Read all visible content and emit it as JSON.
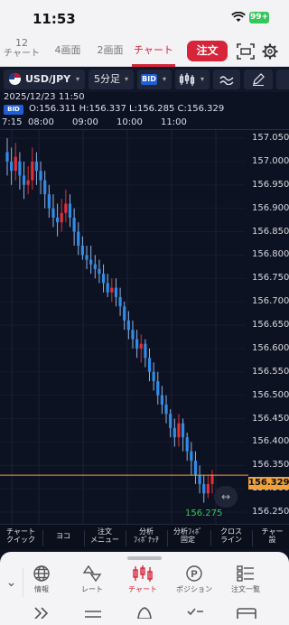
{
  "status": {
    "time": "11:53",
    "battery": "99+"
  },
  "header": {
    "tabs": [
      {
        "top": "12",
        "bottom": "チャート"
      },
      {
        "label": "4画面"
      },
      {
        "label": "2画面"
      },
      {
        "label": "チャート"
      }
    ],
    "order_label": "注文"
  },
  "toolbar": {
    "pair": "USD/JPY",
    "interval": "5分足",
    "price_type": "BID"
  },
  "info": {
    "datetime": "2025/12/23 11:50",
    "bid_tag": "BID",
    "ohlc": "O:156.311 H:156.337 L:156.285 C:156.329"
  },
  "time_axis": [
    "7:15",
    "08:00",
    "09:00",
    "10:00",
    "11:00"
  ],
  "chart_data": {
    "type": "candlestick",
    "title": "",
    "xlabel": "",
    "ylabel": "",
    "ylim": [
      156.23,
      157.1
    ],
    "x": [
      "07:15",
      "08:00",
      "09:00",
      "10:00",
      "11:00"
    ],
    "y_ticks": [
      "157.050",
      "157.000",
      "156.950",
      "156.900",
      "156.850",
      "156.800",
      "156.750",
      "156.700",
      "156.650",
      "156.600",
      "156.550",
      "156.500",
      "156.450",
      "156.400",
      "156.350",
      "156.300",
      "156.250"
    ],
    "current_price": "156.329",
    "low_label": "156.275",
    "series": [
      {
        "values": [
          [
            157.02,
            157.0,
            157.05,
            156.97
          ],
          [
            157.0,
            156.98,
            157.03,
            156.95
          ],
          [
            156.98,
            157.01,
            157.04,
            156.96
          ],
          [
            157.0,
            156.97,
            157.02,
            156.94
          ],
          [
            156.97,
            156.95,
            157.0,
            156.92
          ],
          [
            156.95,
            156.96,
            156.99,
            156.93
          ],
          [
            156.96,
            157.0,
            157.03,
            156.94
          ],
          [
            157.0,
            156.98,
            157.02,
            156.95
          ],
          [
            156.98,
            156.96,
            157.0,
            156.93
          ],
          [
            156.96,
            156.93,
            156.98,
            156.9
          ],
          [
            156.93,
            156.9,
            156.95,
            156.88
          ],
          [
            156.9,
            156.88,
            156.93,
            156.86
          ],
          [
            156.88,
            156.87,
            156.91,
            156.84
          ],
          [
            156.87,
            156.89,
            156.92,
            156.85
          ],
          [
            156.89,
            156.91,
            156.94,
            156.87
          ],
          [
            156.91,
            156.88,
            156.93,
            156.86
          ],
          [
            156.88,
            156.85,
            156.9,
            156.82
          ],
          [
            156.85,
            156.82,
            156.87,
            156.8
          ],
          [
            156.82,
            156.8,
            156.84,
            156.79
          ],
          [
            156.8,
            156.79,
            156.82,
            156.77
          ],
          [
            156.79,
            156.78,
            156.82,
            156.76
          ],
          [
            156.78,
            156.77,
            156.8,
            156.75
          ],
          [
            156.77,
            156.76,
            156.79,
            156.74
          ],
          [
            156.76,
            156.74,
            156.78,
            156.72
          ],
          [
            156.74,
            156.72,
            156.76,
            156.71
          ],
          [
            156.72,
            156.73,
            156.75,
            156.7
          ],
          [
            156.73,
            156.71,
            156.75,
            156.69
          ],
          [
            156.71,
            156.69,
            156.73,
            156.67
          ],
          [
            156.69,
            156.66,
            156.7,
            156.64
          ],
          [
            156.66,
            156.64,
            156.68,
            156.62
          ],
          [
            156.64,
            156.62,
            156.66,
            156.6
          ],
          [
            156.62,
            156.6,
            156.64,
            156.58
          ],
          [
            156.6,
            156.61,
            156.63,
            156.57
          ],
          [
            156.61,
            156.58,
            156.62,
            156.56
          ],
          [
            156.58,
            156.55,
            156.6,
            156.53
          ],
          [
            156.55,
            156.53,
            156.57,
            156.51
          ],
          [
            156.53,
            156.5,
            156.55,
            156.48
          ],
          [
            156.5,
            156.48,
            156.52,
            156.46
          ],
          [
            156.48,
            156.46,
            156.5,
            156.44
          ],
          [
            156.46,
            156.43,
            156.47,
            156.41
          ],
          [
            156.43,
            156.41,
            156.45,
            156.39
          ],
          [
            156.41,
            156.44,
            156.46,
            156.39
          ],
          [
            156.44,
            156.41,
            156.45,
            156.38
          ],
          [
            156.41,
            156.38,
            156.42,
            156.36
          ],
          [
            156.38,
            156.36,
            156.4,
            156.33
          ],
          [
            156.36,
            156.33,
            156.38,
            156.31
          ],
          [
            156.33,
            156.31,
            156.35,
            156.29
          ],
          [
            156.31,
            156.29,
            156.33,
            156.27
          ],
          [
            156.29,
            156.31,
            156.33,
            156.28
          ],
          [
            156.31,
            156.33,
            156.34,
            156.29
          ]
        ]
      }
    ],
    "colors": {
      "up": "#e0303a",
      "down": "#2f8ce8",
      "wick": "#8fb4e6",
      "price_line": "#f0a13a",
      "low": "#35c759"
    }
  },
  "function_bar": [
    {
      "l1": "チャート",
      "l2": "クイック"
    },
    {
      "l1": "ヨコ",
      "l2": ""
    },
    {
      "l1": "注文",
      "l2": "メニュー"
    },
    {
      "l1": "分析",
      "l2": "ﾌｨﾎﾞﾅｯﾁ"
    },
    {
      "l1": "分析ﾌｨﾎﾞ",
      "l2": "固定"
    },
    {
      "l1": "クロス",
      "l2": "ライン"
    },
    {
      "l1": "チャー",
      "l2": "設"
    }
  ],
  "bottom_nav": [
    {
      "label": "情報",
      "icon": "globe-icon"
    },
    {
      "label": "レート",
      "icon": "rate-icon"
    },
    {
      "label": "チャート",
      "icon": "candle-icon"
    },
    {
      "label": "ポジション",
      "icon": "position-icon"
    },
    {
      "label": "注文一覧",
      "icon": "list-icon"
    }
  ]
}
